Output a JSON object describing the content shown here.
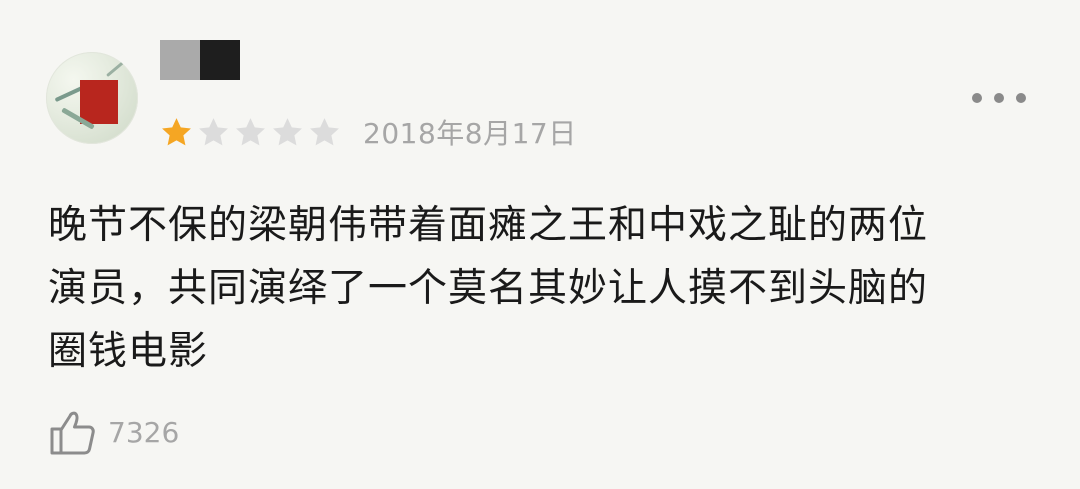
{
  "review": {
    "avatar_icon": "user-avatar",
    "rating": {
      "value": 1,
      "max": 5,
      "filled_color": "#f5a623",
      "empty_color": "#dcdcdc"
    },
    "date": "2018年8月17日",
    "more_icon": "more-horizontal-icon",
    "text_lines": [
      "晚节不保的梁朝伟带着面瘫之王和中戏之耻的两位",
      "演员，共同演绎了一个莫名其妙让人摸不到头脑的",
      "圈钱电影"
    ],
    "like_icon": "thumbs-up-icon",
    "like_count": "7326"
  }
}
